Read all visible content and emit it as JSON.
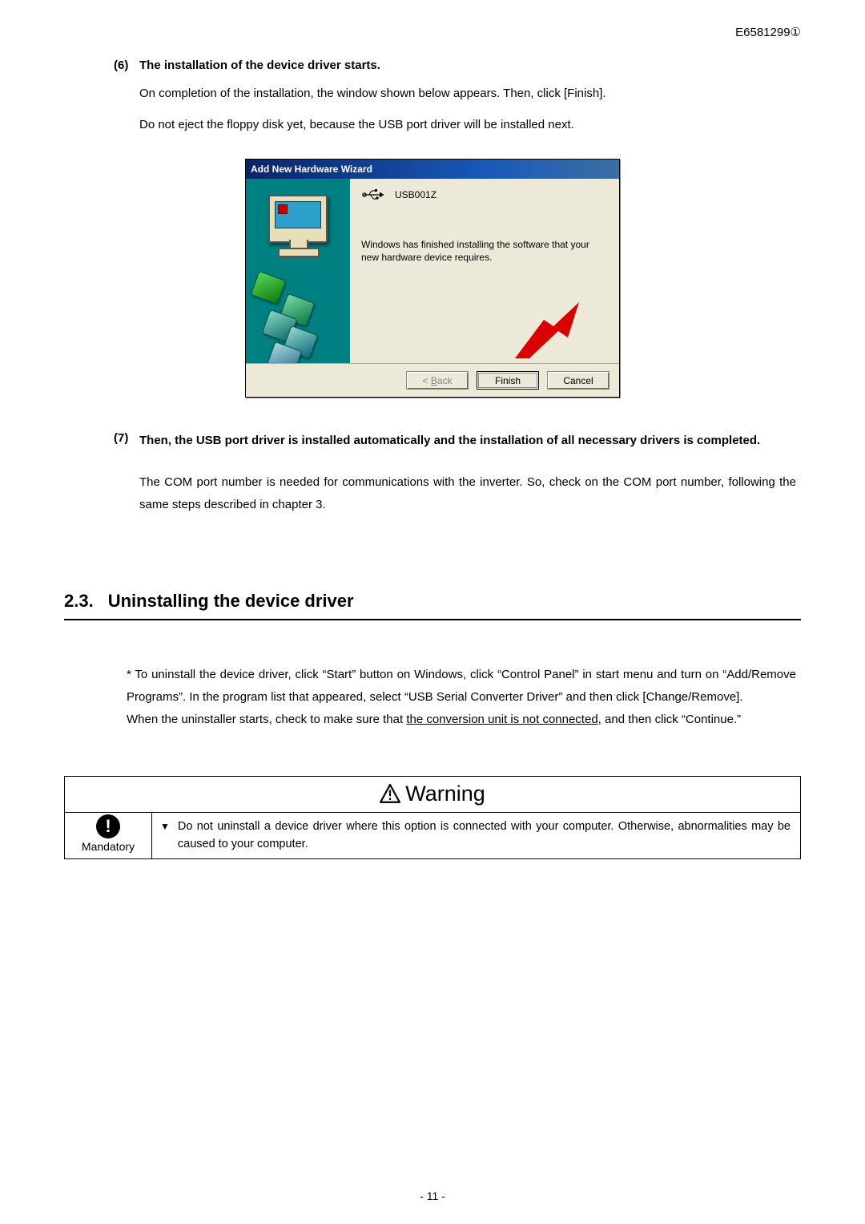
{
  "doc_number": "E6581299①",
  "step6": {
    "num": "(6)",
    "title": "The installation of the device driver starts.",
    "line1": "On completion of the installation, the window shown below appears. Then, click [Finish].",
    "line2": "Do not eject the floppy disk yet, because the USB port driver will be installed next."
  },
  "dialog": {
    "title": "Add New Hardware Wizard",
    "device": "USB001Z",
    "finish_text": "Windows has finished installing the software that your new hardware device requires.",
    "back_u": "B",
    "back_rest": "ack",
    "finish_label": "Finish",
    "cancel_label": "Cancel"
  },
  "step7": {
    "num": "(7)",
    "title": "Then, the USB port driver is installed automatically and the installation of all necessary drivers is completed.",
    "body": "The COM port number is needed for communications with the inverter. So, check on the COM port number, following the same steps described in chapter 3."
  },
  "section23": {
    "num": "2.3.",
    "title": "Uninstalling the device driver",
    "body_pre": "* To uninstall the device driver, click “Start” button on Windows, click “Control Panel” in start menu and turn on “Add/Remove Programs”. In the program list that appeared, select “USB Serial Converter Driver” and then click [Change/Remove].",
    "body_mid_pre": "When the uninstaller starts, check to make sure that ",
    "body_mid_u": "the conversion unit is not connected,",
    "body_mid_post": " and then click “Continue.”"
  },
  "warning": {
    "label": "Warning",
    "mandatory": "Mandatory",
    "bullet": "▼",
    "text": "Do not uninstall a device driver where this option is connected with your computer. Otherwise, abnormalities may be caused to your computer."
  },
  "page_number": "- 11 -"
}
